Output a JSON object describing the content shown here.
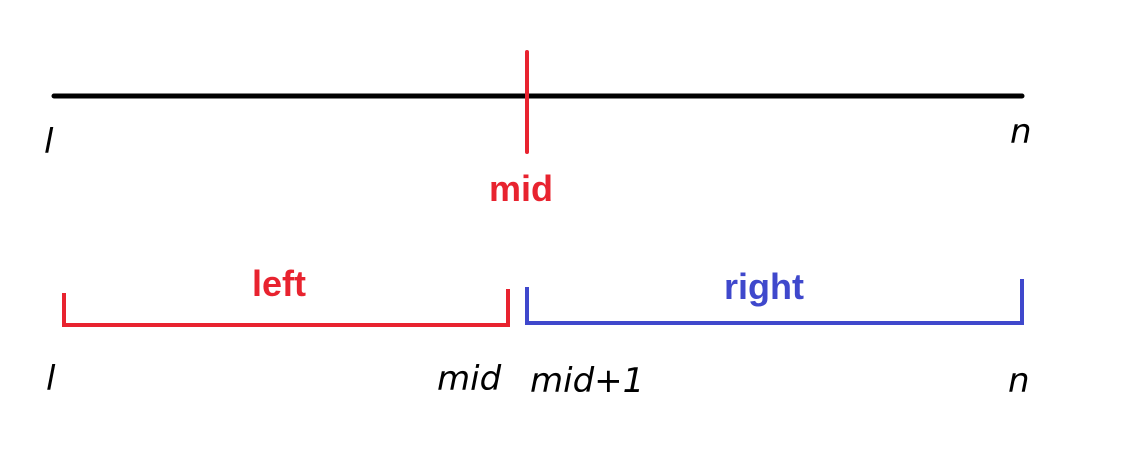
{
  "colors": {
    "line": "#000000",
    "mid": "#e8232f",
    "left": "#e8232f",
    "right": "#3f48cc",
    "ink": "#000000"
  },
  "top_line": {
    "start_label": "l",
    "end_label": "n",
    "mid_label": "mid"
  },
  "left_segment": {
    "label": "left",
    "start_label": "l",
    "end_label": "mid"
  },
  "right_segment": {
    "label": "right",
    "start_label": "mid+1",
    "end_label": "n"
  }
}
